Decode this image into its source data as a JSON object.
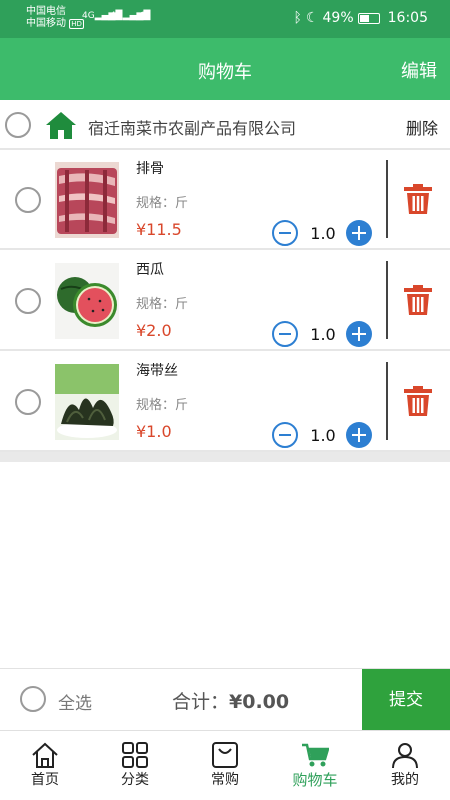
{
  "statusbar": {
    "carrier1": "中国电信",
    "carrier2": "中国移动",
    "hd": "HD",
    "sig1": "4G",
    "sig2": "4G",
    "battery": "49%",
    "time": "16:05"
  },
  "navbar": {
    "title": "购物车",
    "edit": "编辑"
  },
  "store": {
    "name": "宿迁南菜市农副产品有限公司",
    "delete": "删除"
  },
  "items": [
    {
      "name": "排骨",
      "spec": "规格：斤",
      "price": "¥11.5",
      "qty": "1.0"
    },
    {
      "name": "西瓜",
      "spec": "规格：斤",
      "price": "¥2.0",
      "qty": "1.0"
    },
    {
      "name": "海带丝",
      "spec": "规格：斤",
      "price": "¥1.0",
      "qty": "1.0"
    }
  ],
  "footer": {
    "select_all": "全选",
    "total_label": "合计：",
    "total_value": "¥0.00",
    "submit": "提交"
  },
  "tabs": [
    {
      "label": "首页",
      "icon": "home-icon"
    },
    {
      "label": "分类",
      "icon": "grid-icon"
    },
    {
      "label": "常购",
      "icon": "bag-icon"
    },
    {
      "label": "购物车",
      "icon": "cart-icon",
      "active": true
    },
    {
      "label": "我的",
      "icon": "user-icon"
    }
  ],
  "colors": {
    "statusbar": "#2fa05a",
    "navbar": "#3dbb6b",
    "price": "#d9472b",
    "stepper": "#2d7fd2",
    "trash": "#d9472b",
    "submit": "#2fa23d",
    "active_tab": "#2fa05a"
  }
}
